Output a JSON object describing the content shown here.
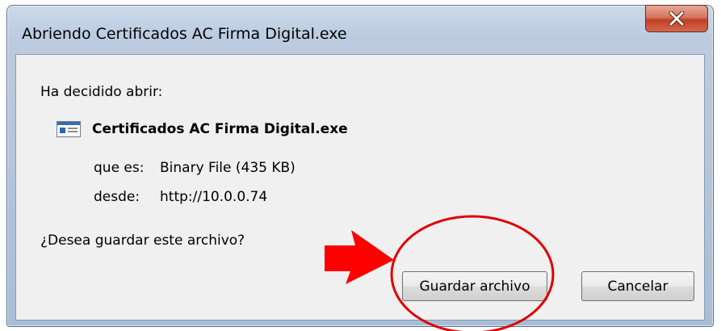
{
  "window": {
    "title": "Abriendo Certificados AC Firma Digital.exe",
    "close_glyph": "X"
  },
  "dialog": {
    "intro": "Ha decidido abrir:",
    "file_name": "Certificados AC Firma Digital.exe",
    "file_icon": "exe-file-icon",
    "type_label": "que es:",
    "type_value": "Binary File (435 KB)",
    "from_label": "desde:",
    "from_value": "http://10.0.0.74",
    "question": "¿Desea guardar este archivo?"
  },
  "buttons": {
    "save_label": "Guardar archivo",
    "cancel_label": "Cancelar"
  },
  "annotations": {
    "arrow_icon": "red-arrow-icon",
    "highlight": "red-ellipse-highlight",
    "color": "#ff0000"
  }
}
